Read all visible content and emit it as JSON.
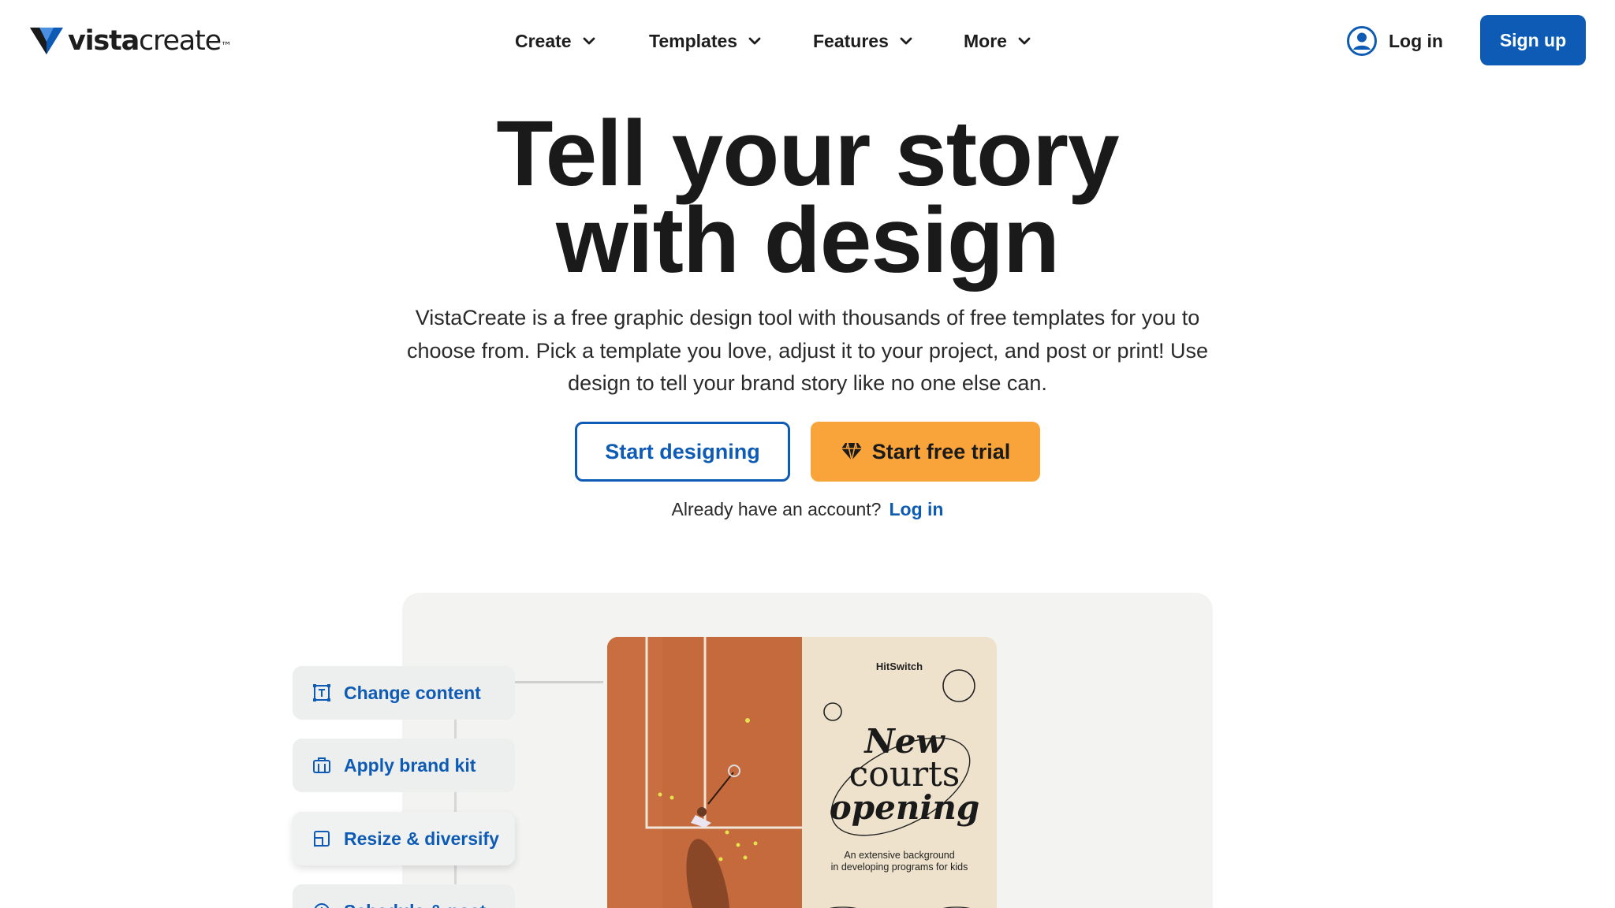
{
  "brand": {
    "name_bold": "vista",
    "name_regular": "create",
    "trademark": "™",
    "accent_color": "#0d5bb5"
  },
  "nav": {
    "items": [
      {
        "label": "Create"
      },
      {
        "label": "Templates"
      },
      {
        "label": "Features"
      },
      {
        "label": "More"
      }
    ],
    "login_label": "Log in",
    "signup_label": "Sign up"
  },
  "hero": {
    "title_line1": "Tell your story",
    "title_line2": "with design",
    "subtitle_line1": "VistaCreate is a free graphic design tool with thousands of free templates for you to",
    "subtitle_line2": "choose from. Pick a template you love, adjust it to your project, and post or print! Use",
    "subtitle_line3": "design to tell your brand story like no one else can.",
    "start_designing_label": "Start designing",
    "free_trial_label": "Start free trial",
    "free_trial_color": "#f9a43b",
    "already_text": "Already have an account?",
    "already_link": "Log in"
  },
  "features": [
    {
      "label": "Change content",
      "icon": "text-frame-icon"
    },
    {
      "label": "Apply brand kit",
      "icon": "brand-kit-icon"
    },
    {
      "label": "Resize & diversify",
      "icon": "resize-icon"
    },
    {
      "label": "Schedule & post",
      "icon": "schedule-icon"
    }
  ],
  "poster": {
    "brand": "HitSwitch",
    "headline_line1": "New",
    "headline_line2": "courts",
    "headline_line3": "opening",
    "desc_line1": "An extensive background",
    "desc_line2": "in developing programs for kids",
    "court_color": "#c56a3d",
    "cream_color": "#efe2cc"
  }
}
